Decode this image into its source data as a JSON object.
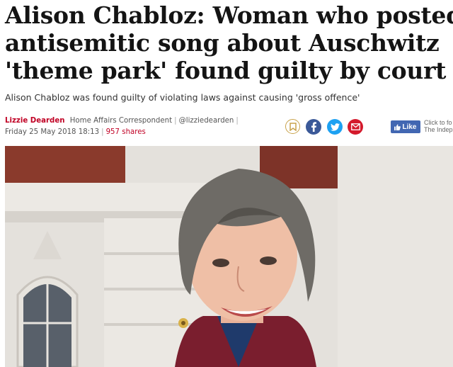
{
  "article": {
    "headline_lines": [
      "Alison Chabloz: Woman who posted",
      "antisemitic song about Auschwitz",
      "'theme park' found guilty by court"
    ],
    "standfirst": "Alison Chabloz was found guilty of violating laws against causing 'gross offence'",
    "author": "Lizzie Dearden",
    "author_role": "Home Affairs Correspondent",
    "author_handle": "@lizziedearden",
    "date": "Friday 25 May 2018 18:13",
    "shares": "957 shares"
  },
  "share_bar": {
    "icons": [
      "bookmark-icon",
      "facebook-icon",
      "twitter-icon",
      "email-icon"
    ],
    "like_label": "Like",
    "like_caption_line1": "Click to fo",
    "like_caption_line2": "The Indep"
  },
  "colors": {
    "headline": "#141414",
    "author": "#c00024",
    "facebook": "#3b5998",
    "twitter": "#1da1f2",
    "email": "#d41a2c",
    "like": "#4267b2"
  }
}
